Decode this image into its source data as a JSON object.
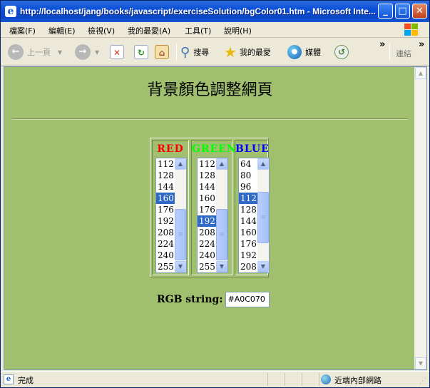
{
  "window": {
    "title": "http://localhost/jang/books/javascript/exerciseSolution/bgColor01.htm - Microsoft Inte...",
    "minimize_glyph": "_",
    "maximize_glyph": "□",
    "close_glyph": "✕"
  },
  "menu": [
    {
      "label": "檔案(F)"
    },
    {
      "label": "編輯(E)"
    },
    {
      "label": "檢視(V)"
    },
    {
      "label": "我的最愛(A)"
    },
    {
      "label": "工具(T)"
    },
    {
      "label": "說明(H)"
    }
  ],
  "toolbar": {
    "back_label": "上一頁",
    "search_label": "搜尋",
    "favorites_label": "我的最愛",
    "media_label": "媒體",
    "links_label": "連結",
    "more_glyph": "»"
  },
  "page": {
    "heading": "背景顏色調整網頁",
    "background_color": "#A0C070",
    "channels": [
      {
        "name": "RED",
        "color": "#FF0000",
        "options": [
          "112",
          "128",
          "144",
          "160",
          "176",
          "192",
          "208",
          "224",
          "240",
          "255"
        ],
        "selected": "160"
      },
      {
        "name": "GREEN",
        "color": "#00FF00",
        "options": [
          "112",
          "128",
          "144",
          "160",
          "176",
          "192",
          "208",
          "224",
          "240",
          "255"
        ],
        "selected": "192"
      },
      {
        "name": "BLUE",
        "color": "#0000FF",
        "options": [
          "64",
          "80",
          "96",
          "112",
          "128",
          "144",
          "160",
          "176",
          "192",
          "208"
        ],
        "selected": "112"
      }
    ],
    "rgb_label": "RGB string:",
    "rgb_value": "#A0C070"
  },
  "status": {
    "text": "完成",
    "zone": "近端內部網路"
  }
}
